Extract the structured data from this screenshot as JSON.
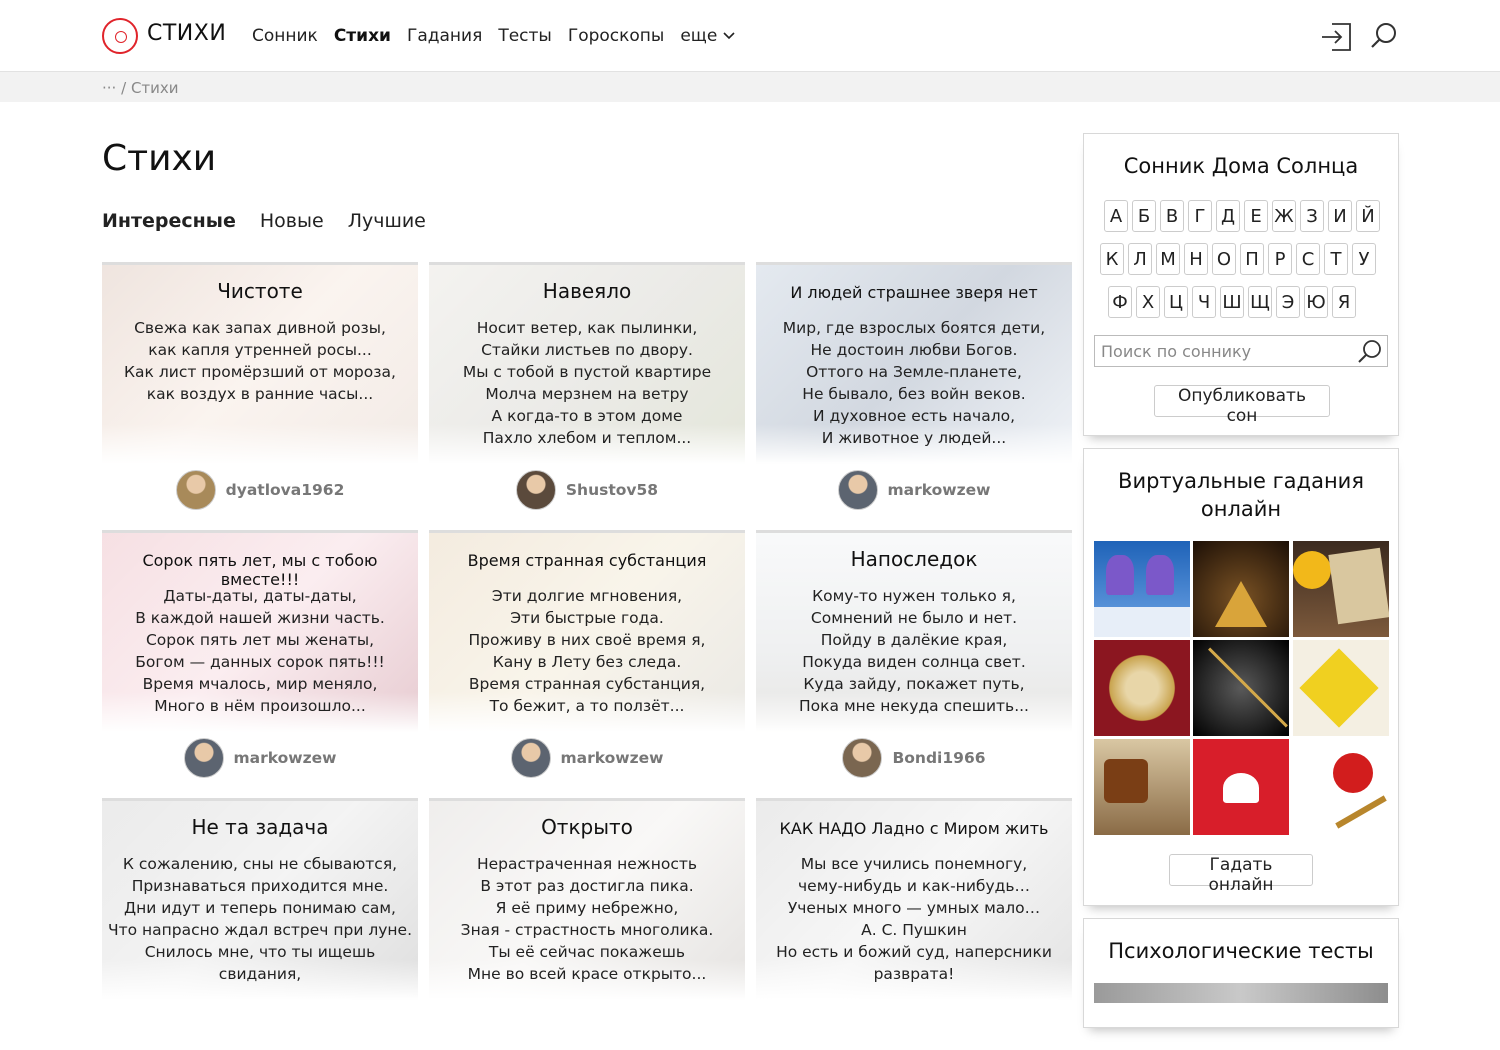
{
  "header": {
    "brand": "СТИХИ",
    "nav": [
      "Сонник",
      "Стихи",
      "Гадания",
      "Тесты",
      "Гороскопы"
    ],
    "nav_more": "еще",
    "accent": "#e0242b"
  },
  "breadcrumb": {
    "ellipsis": "···",
    "separator": "/",
    "current": "Стихи"
  },
  "page": {
    "title": "Стихи",
    "tabs": [
      "Интересные",
      "Новые",
      "Лучшие"
    ]
  },
  "cards": [
    {
      "title": "Чистоте",
      "lines": [
        "Свежа как запах дивной розы,",
        "как капля утренней росы...",
        "Как лист промёрзший от мороза,",
        "как воздух в ранние часы..."
      ],
      "author": "dyatlova1962"
    },
    {
      "title": "Навеяло",
      "lines": [
        "Носит ветер, как пылинки,",
        "Стайки листьев по двору.",
        "Мы с тобой в пустой квартире",
        "Молча мерзнем на ветру",
        "А когда-то в этом доме",
        "Пахло хлебом и теплом..."
      ],
      "author": "Shustov58"
    },
    {
      "title": "И людей страшнее зверя нет",
      "lines": [
        "Мир, где взрослых боятся дети,",
        "Не достоин любви Богов.",
        "Оттого на Земле-планете,",
        "Не бывало, без войн веков.",
        "И духовное есть начало,",
        "И животное у людей..."
      ],
      "author": "markowzew"
    },
    {
      "title": "Сорок пять лет, мы с тобою вместе!!!",
      "lines": [
        "Даты-даты, даты-даты,",
        "В каждой нашей жизни часть.",
        "Сорок пять лет мы женаты,",
        "Богом — данных сорок пять!!!",
        "Время мчалось, мир меняло,",
        "Много в нём произошло..."
      ],
      "author": "markowzew"
    },
    {
      "title": "Время странная субстанция",
      "lines": [
        "Эти долгие мгновения,",
        "Эти быстрые года.",
        "Проживу в них своё время я,",
        "Кану в Лету без следа.",
        "Время странная субстанция,",
        "То бежит, а то ползёт..."
      ],
      "author": "markowzew"
    },
    {
      "title": "Напоследок",
      "lines": [
        "Кому-то нужен только я,",
        "Сомнений не было и нет.",
        "Пойду в далёкие края,",
        "Покуда виден солнца свет.",
        "Куда зайду, покажет путь,",
        "Пока мне некуда спешить..."
      ],
      "author": "Bondi1966"
    },
    {
      "title": "Не та задача",
      "lines": [
        "К сожалению, сны не сбываются,",
        "Признаваться приходится мне.",
        "Дни идут и теперь понимаю сам,",
        "Что напрасно ждал встреч при луне.",
        "Снилось мне, что ты ищешь",
        "свидания,"
      ],
      "author": ""
    },
    {
      "title": "Открыто",
      "lines": [
        "Нерастраченная нежность",
        "В этот раз достигла пика.",
        "Я её приму небрежно,",
        "Зная - страстность многолика.",
        "Ты её сейчас покажешь",
        "Мне во всей красе открыто..."
      ],
      "author": ""
    },
    {
      "title": "КАК НАДО Ладно с Миром жить",
      "lines": [
        "Мы все учились понемногу,",
        "чему-нибудь и как-нибудь…",
        "Ученых много — умных мало…",
        "А. С. Пушкин",
        "Но есть и божий суд, наперсники",
        "разврата!"
      ],
      "author": ""
    }
  ],
  "sidebar": {
    "dream_title": "Сонник Дома Солнца",
    "letters_row1": [
      "А",
      "Б",
      "В",
      "Г",
      "Д",
      "Е",
      "Ж",
      "З",
      "И",
      "Й"
    ],
    "letters_row2": [
      "К",
      "Л",
      "М",
      "Н",
      "О",
      "П",
      "Р",
      "С",
      "Т",
      "У"
    ],
    "letters_row3": [
      "Ф",
      "Х",
      "Ц",
      "Ч",
      "Ш",
      "Щ",
      "Э",
      "Ю",
      "Я"
    ],
    "search_placeholder": "Поиск по соннику",
    "publish_label": "Опубликовать сон",
    "fortune_title_1": "Виртуальные гадания",
    "fortune_title_2": "онлайн",
    "fortune_button": "Гадать онлайн",
    "tests_title": "Психологические тесты"
  }
}
